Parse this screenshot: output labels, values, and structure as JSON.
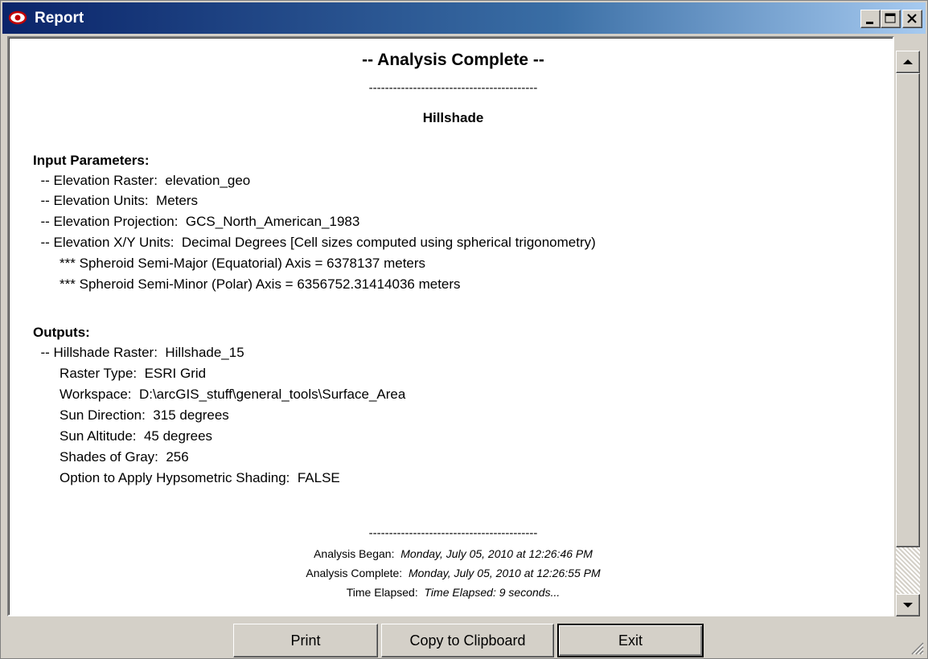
{
  "window": {
    "title": "Report",
    "icon": "eye-icon",
    "controls": [
      "minimize-icon",
      "maximize-icon",
      "close-icon"
    ]
  },
  "report": {
    "heading": "-- Analysis Complete --",
    "separator": "------------------------------------------",
    "subheading": "Hillshade",
    "input_section": "Input Parameters:",
    "inputs": [
      "  -- Elevation Raster:  elevation_geo",
      "  -- Elevation Units:  Meters",
      "  -- Elevation Projection:  GCS_North_American_1983",
      "  -- Elevation X/Y Units:  Decimal Degrees [Cell sizes computed using spherical trigonometry)",
      "       *** Spheroid Semi-Major (Equatorial) Axis = 6378137 meters",
      "       *** Spheroid Semi-Minor (Polar) Axis = 6356752.31414036 meters"
    ],
    "output_section": "Outputs:",
    "outputs": [
      "  -- Hillshade Raster:  Hillshade_15",
      "       Raster Type:  ESRI Grid",
      "       Workspace:  D:\\arcGIS_stuff\\general_tools\\Surface_Area",
      "       Sun Direction:  315 degrees",
      "       Sun Altitude:  45 degrees",
      "       Shades of Gray:  256",
      "       Option to Apply Hypsometric Shading:  FALSE"
    ],
    "footer_separator": "------------------------------------------",
    "began_label": "Analysis Began:  ",
    "began_value": "Monday, July 05, 2010 at 12:26:46 PM",
    "complete_label": "Analysis Complete:  ",
    "complete_value": "Monday, July 05, 2010 at 12:26:55 PM",
    "elapsed_label": "Time Elapsed:  ",
    "elapsed_value": "Time Elapsed: 9 seconds..."
  },
  "buttons": {
    "print": "Print",
    "copy": "Copy to Clipboard",
    "exit": "Exit"
  }
}
